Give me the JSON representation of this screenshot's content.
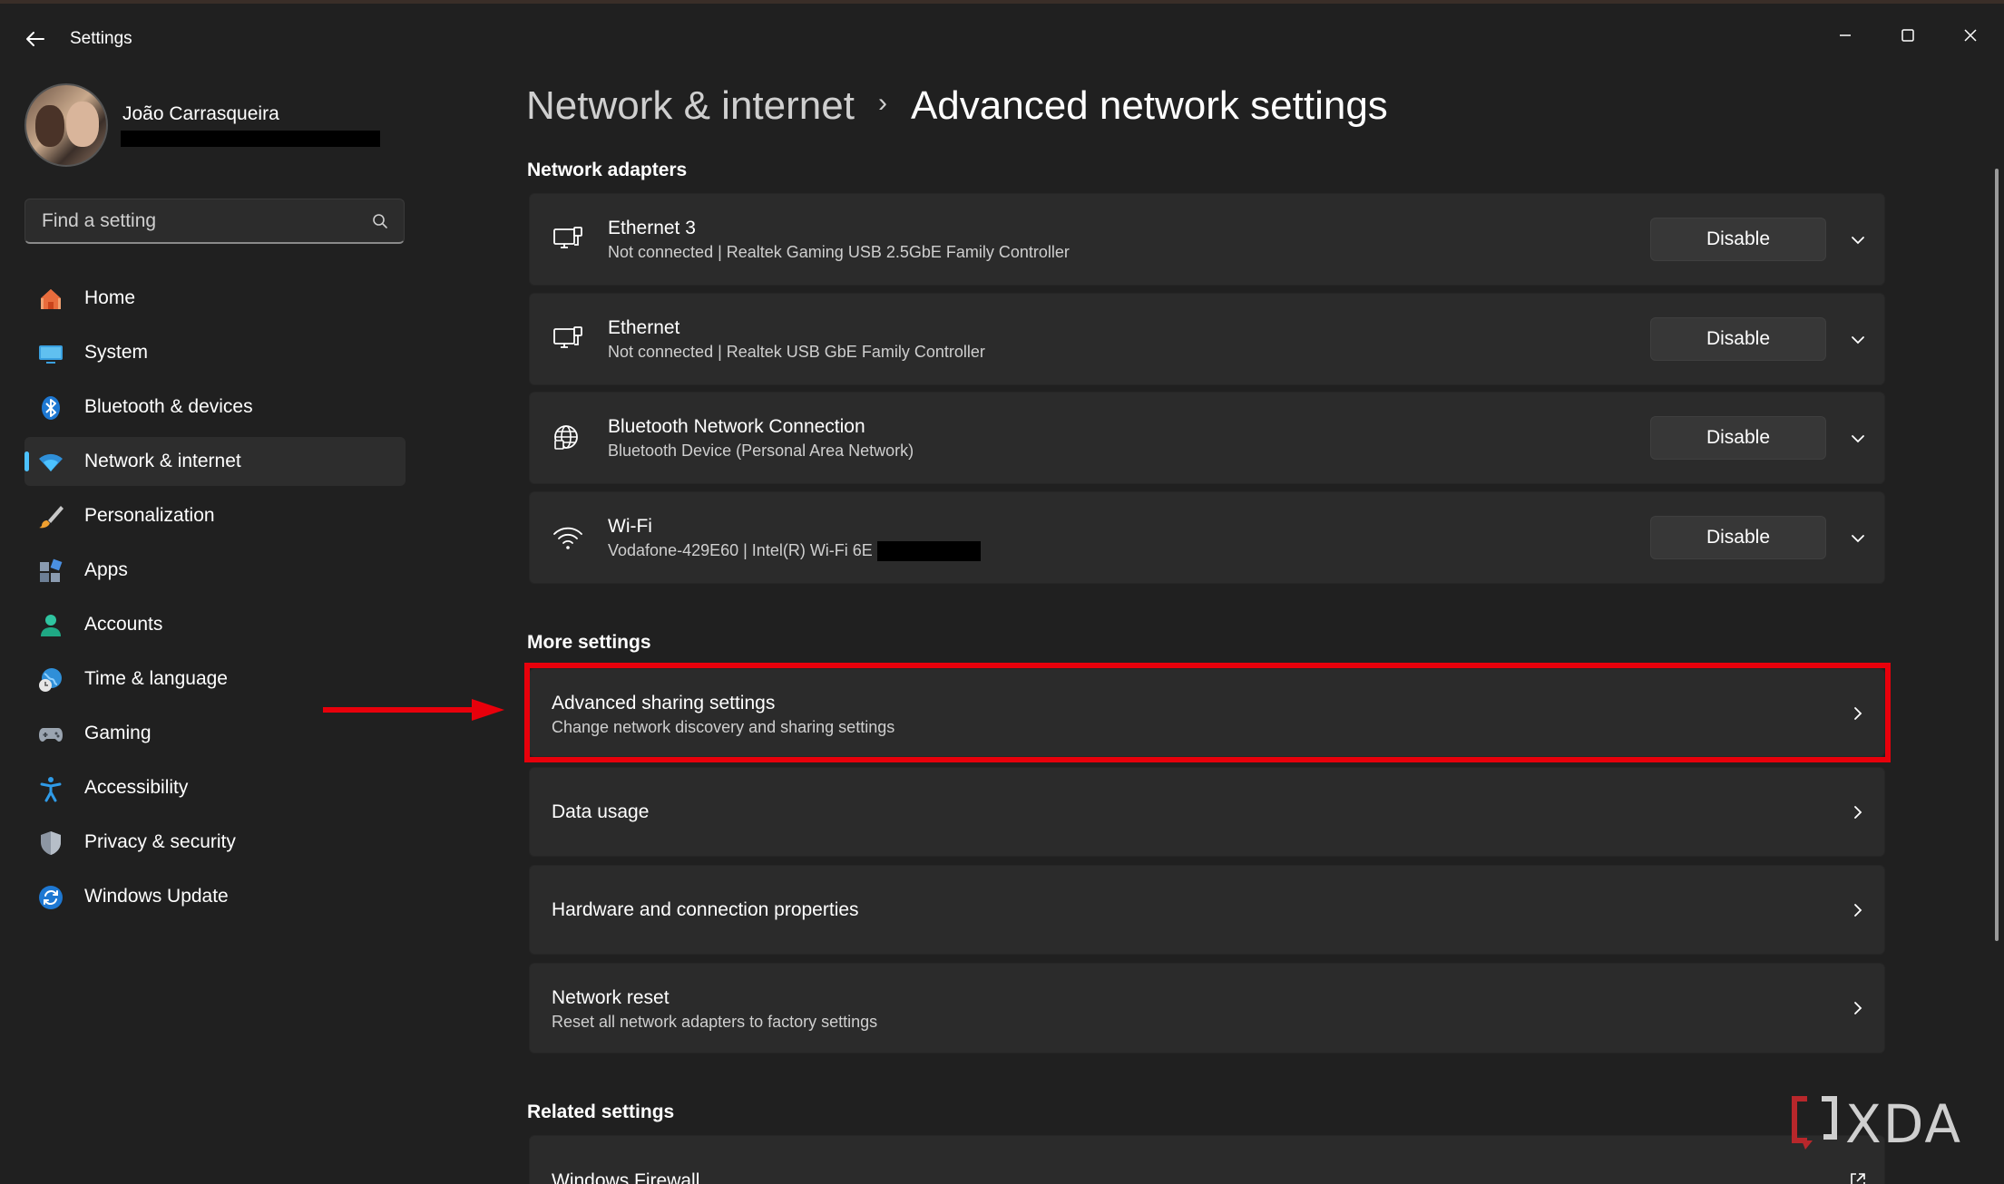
{
  "window": {
    "title": "Settings"
  },
  "profile": {
    "name": "João Carrasqueira"
  },
  "search": {
    "placeholder": "Find a setting"
  },
  "sidebar": {
    "items": [
      {
        "label": "Home",
        "icon": "home-icon"
      },
      {
        "label": "System",
        "icon": "system-icon"
      },
      {
        "label": "Bluetooth & devices",
        "icon": "bluetooth-icon"
      },
      {
        "label": "Network & internet",
        "icon": "wifi-icon",
        "active": true
      },
      {
        "label": "Personalization",
        "icon": "brush-icon"
      },
      {
        "label": "Apps",
        "icon": "apps-icon"
      },
      {
        "label": "Accounts",
        "icon": "accounts-icon"
      },
      {
        "label": "Time & language",
        "icon": "globe-clock-icon"
      },
      {
        "label": "Gaming",
        "icon": "gamepad-icon"
      },
      {
        "label": "Accessibility",
        "icon": "accessibility-icon"
      },
      {
        "label": "Privacy & security",
        "icon": "shield-icon"
      },
      {
        "label": "Windows Update",
        "icon": "update-icon"
      }
    ]
  },
  "breadcrumb": {
    "parent": "Network & internet",
    "separator": "›",
    "current": "Advanced network settings"
  },
  "sections": {
    "adapters_title": "Network adapters",
    "more_title": "More settings",
    "related_title": "Related settings"
  },
  "adapters": [
    {
      "name": "Ethernet 3",
      "detail": "Not connected | Realtek Gaming USB 2.5GbE Family Controller",
      "button": "Disable",
      "icon": "ethernet-icon"
    },
    {
      "name": "Ethernet",
      "detail": "Not connected | Realtek USB GbE Family Controller",
      "button": "Disable",
      "icon": "ethernet-icon"
    },
    {
      "name": "Bluetooth Network Connection",
      "detail": "Bluetooth Device (Personal Area Network)",
      "button": "Disable",
      "icon": "globe-network-icon"
    },
    {
      "name": "Wi-Fi",
      "detail": "Vodafone-429E60 | Intel(R) Wi-Fi 6E",
      "button": "Disable",
      "icon": "wifi-icon"
    }
  ],
  "more_settings": [
    {
      "title": "Advanced sharing settings",
      "subtitle": "Change network discovery and sharing settings",
      "highlighted": true
    },
    {
      "title": "Data usage",
      "subtitle": ""
    },
    {
      "title": "Hardware and connection properties",
      "subtitle": ""
    },
    {
      "title": "Network reset",
      "subtitle": "Reset all network adapters to factory settings"
    }
  ],
  "related_settings": [
    {
      "title": "Windows Firewall"
    }
  ],
  "watermark": {
    "text": "XDA"
  },
  "colors": {
    "accent": "#4cc2ff",
    "highlight": "#e8000b",
    "background": "#202020",
    "card": "#2b2b2b"
  }
}
